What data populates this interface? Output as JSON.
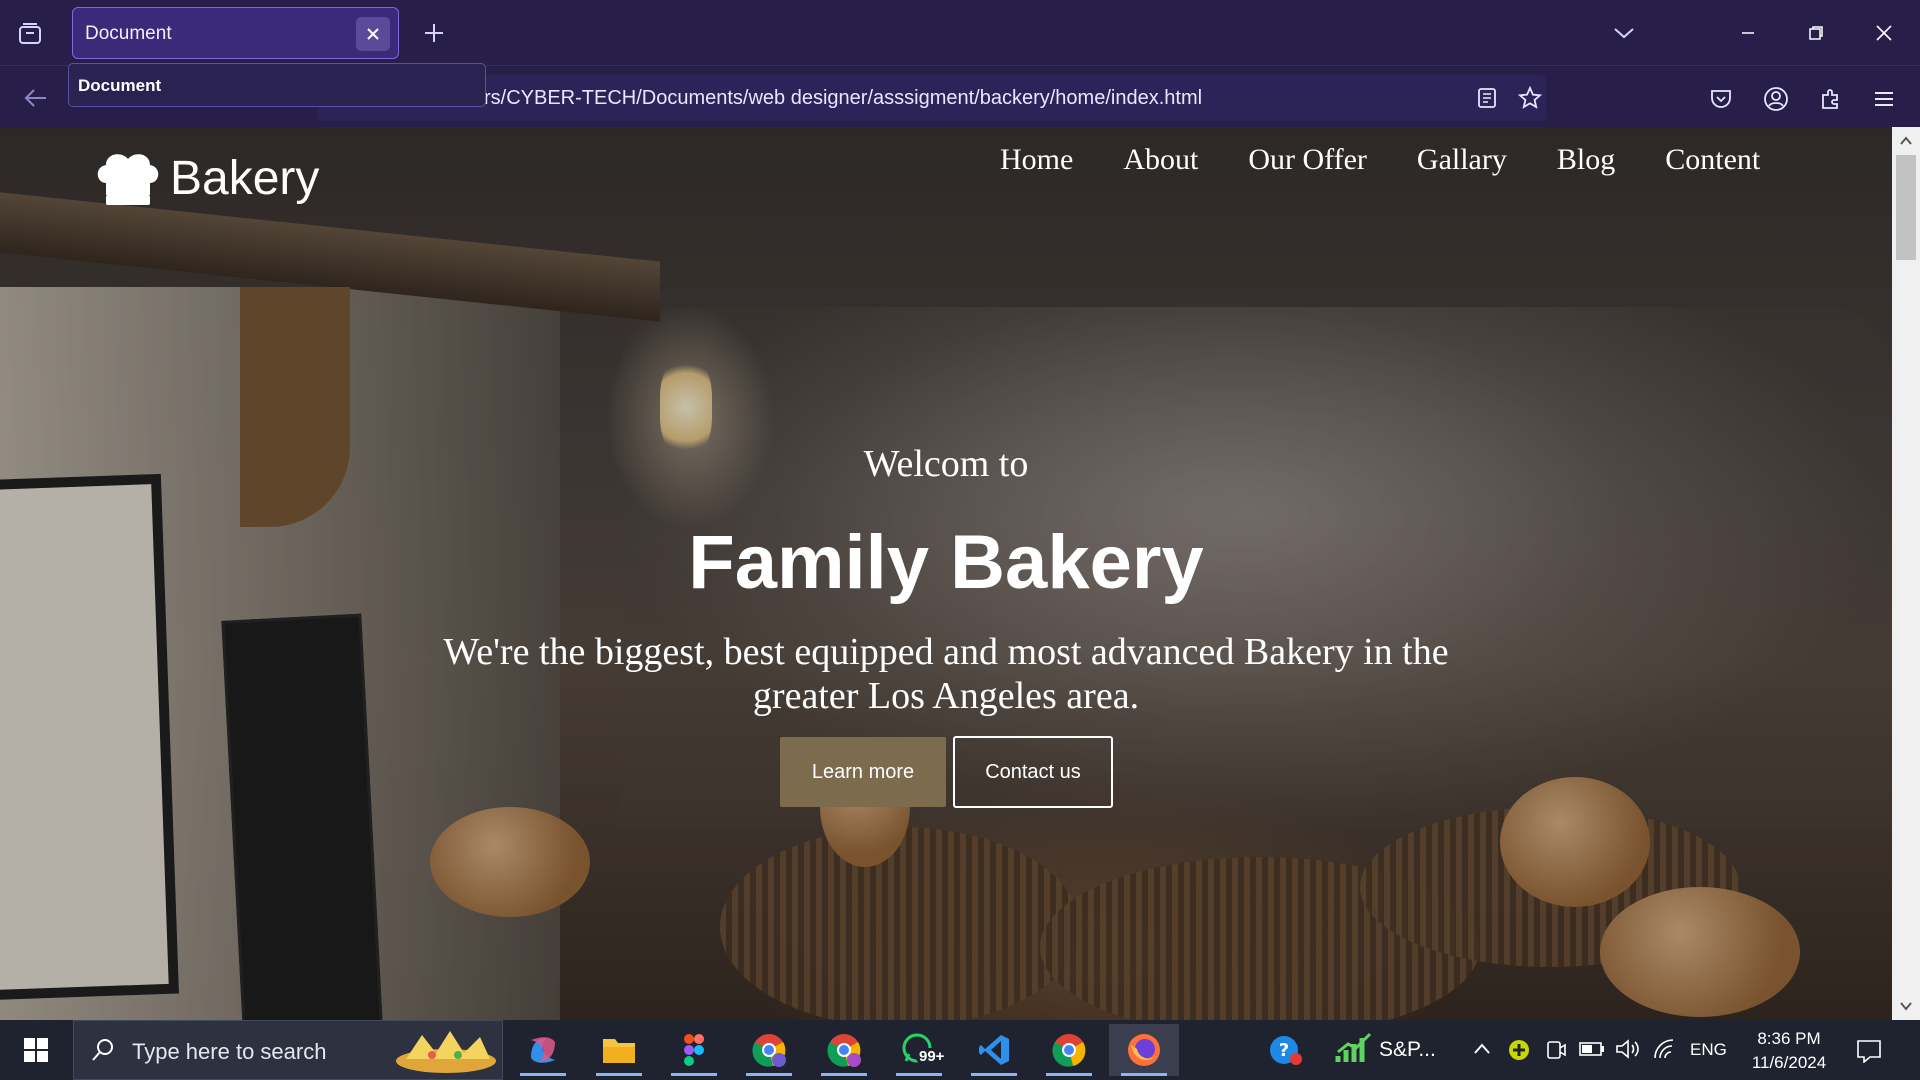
{
  "browser": {
    "tab_title": "Document",
    "tooltip": "Document",
    "url": "rs/CYBER-TECH/Documents/web designer/asssigment/backery/home/index.html"
  },
  "site": {
    "logo_text": "Bakery",
    "nav": [
      "Home",
      "About",
      "Our Offer",
      "Gallary",
      "Blog",
      "Content"
    ],
    "hero": {
      "subtitle": "Welcom to",
      "title": "Family Bakery",
      "description": "We're the biggest, best equipped and most advanced Bakery in the greater Los Angeles area.",
      "learn_more": "Learn more",
      "contact_us": "Contact us"
    }
  },
  "taskbar": {
    "search_placeholder": "Type here to search",
    "whatsapp_badge": "99+",
    "stock_label": "S&P...",
    "language": "ENG",
    "time": "8:36 PM",
    "date": "11/6/2024"
  },
  "colors": {
    "chrome_bg": "#271f4a",
    "tab_active": "#3b2a7a",
    "accent_button": "#7d6b4d",
    "taskbar_bg": "#1f2330"
  }
}
